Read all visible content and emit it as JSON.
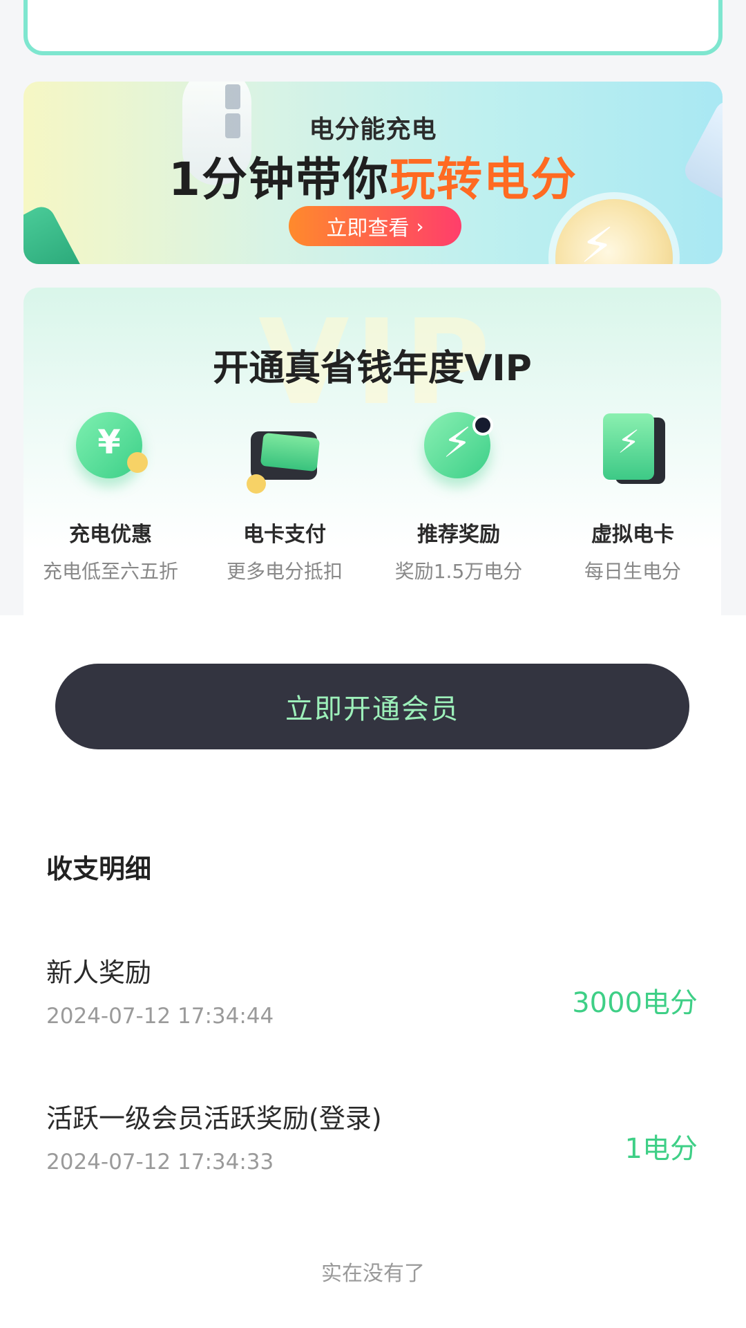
{
  "banner": {
    "subtitle": "电分能充电",
    "headline_prefix": "1分钟带你",
    "headline_accent": "玩转电分",
    "cta_label": "立即查看",
    "cta_chevron": "›"
  },
  "vip": {
    "title": "开通真省钱年度VIP",
    "watermark": "VIP",
    "benefits": [
      {
        "name": "充电优惠",
        "desc": "充电低至六五折",
        "icon": "yen-coin-icon"
      },
      {
        "name": "电卡支付",
        "desc": "更多电分抵扣",
        "icon": "wallet-icon"
      },
      {
        "name": "推荐奖励",
        "desc": "奖励1.5万电分",
        "icon": "bolt-coin-icon"
      },
      {
        "name": "虚拟电卡",
        "desc": "每日生电分",
        "icon": "charge-card-icon"
      }
    ],
    "join_button": "立即开通会员"
  },
  "transactions": {
    "title": "收支明细",
    "items": [
      {
        "title": "新人奖励",
        "time": "2024-07-12 17:34:44",
        "amount": "3000电分"
      },
      {
        "title": "活跃一级会员活跃奖励(登录)",
        "time": "2024-07-12 17:34:33",
        "amount": "1电分"
      }
    ],
    "end_note": "实在没有了"
  },
  "colors": {
    "accent_green": "#3ecf86",
    "accent_orange": "#ff6a22",
    "button_dark": "#333440"
  }
}
